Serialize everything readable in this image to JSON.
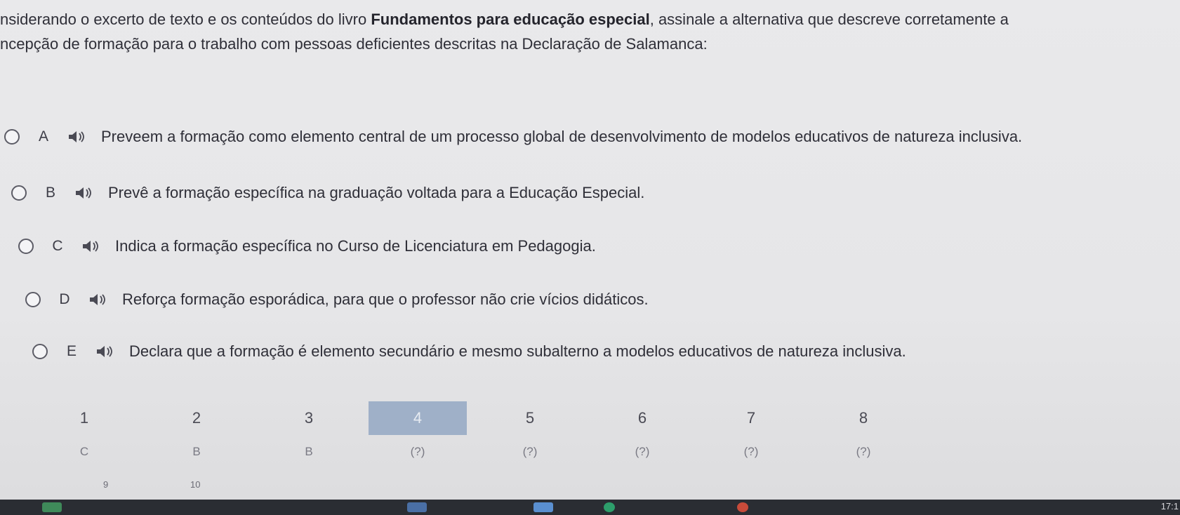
{
  "question": {
    "line1_pre": "nsiderando o excerto de texto  e os conteúdos do livro ",
    "line1_bold": "Fundamentos para educação especial",
    "line1_post": ", assinale a alternativa que descreve corretamente a",
    "line2": "ncepção de formação para o trabalho com pessoas deficientes descritas na Declaração de Salamanca:"
  },
  "options": [
    {
      "letter": "A",
      "text": "Preveem a  formação como elemento central de um processo global de desenvolvimento de modelos educativos de natureza inclusiva."
    },
    {
      "letter": "B",
      "text": "Prevê a formação específica na graduação voltada para a Educação Especial."
    },
    {
      "letter": "C",
      "text": "Indica a formação específica no Curso de Licenciatura em Pedagogia."
    },
    {
      "letter": "D",
      "text": "Reforça formação esporádica, para que o professor não crie vícios didáticos."
    },
    {
      "letter": "E",
      "text": "Declara que a  formação é elemento secundário e mesmo subalterno a modelos educativos de natureza inclusiva."
    }
  ],
  "navigation": {
    "questions": [
      {
        "number": "1",
        "answer": "C"
      },
      {
        "number": "2",
        "answer": "B"
      },
      {
        "number": "3",
        "answer": "B"
      },
      {
        "number": "4",
        "answer": "(?)",
        "active": true
      },
      {
        "number": "5",
        "answer": "(?)"
      },
      {
        "number": "6",
        "answer": "(?)"
      },
      {
        "number": "7",
        "answer": "(?)"
      },
      {
        "number": "8",
        "answer": "(?)"
      }
    ],
    "next_row": [
      "9",
      "10"
    ]
  },
  "taskbar": {
    "clock": "17:1"
  },
  "colors": {
    "active_cell": "#9fb0c8",
    "taskbar": "#2a2d33"
  }
}
